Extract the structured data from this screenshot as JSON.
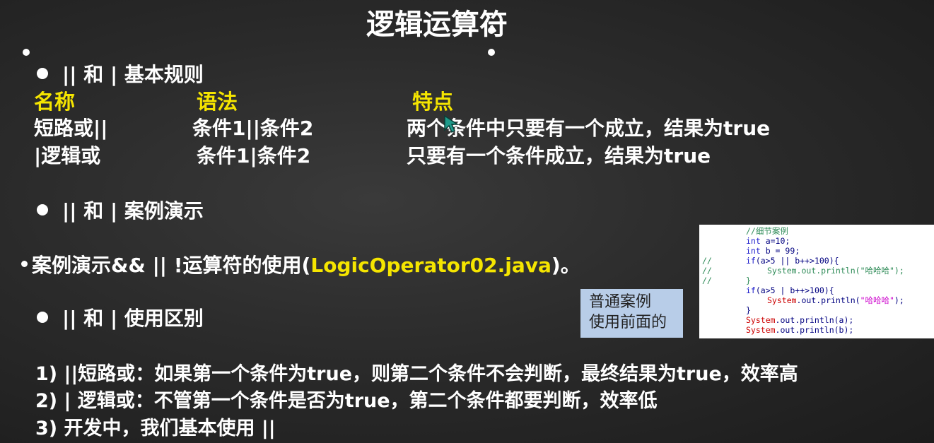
{
  "title": "逻辑运算符",
  "section1": {
    "heading": "|| 和 | 基本规则",
    "col_headers": [
      "名称",
      "语法",
      "特点"
    ],
    "rows": [
      {
        "name": "短路或||",
        "syntax": "条件1||条件2",
        "feature": "两个条件中只要有一个成立，结果为true"
      },
      {
        "name": "|逻辑或",
        "syntax": "条件1|条件2",
        "feature": "只要有一个条件成立，结果为true"
      }
    ]
  },
  "section2": {
    "heading": "|| 和 | 案例演示"
  },
  "demo_line": {
    "prefix": "案例演示&& ||  !运算符的使用(",
    "file": "LogicOperator02.java",
    "suffix": ")。"
  },
  "section3": {
    "heading": "|| 和 | 使用区别"
  },
  "differences": [
    "1) ||短路或：如果第一个条件为true，则第二个条件不会判断，最终结果为true，效率高",
    "2) | 逻辑或：不管第一个条件是否为true，第二个条件都要判断，效率低",
    "3) 开发中，我们基本使用 ||"
  ],
  "note": {
    "line1": "普通案例",
    "line2": "使用前面的"
  },
  "code": {
    "l1": "//细节案例",
    "l2_kw": "int",
    "l2_rest": " a=10;",
    "l3_kw": "int",
    "l3_rest": " b = 99;",
    "l4_cm": "//",
    "l4_kw": "if",
    "l4_rest": "(a>5 || b++>100){",
    "l5_cm": "//",
    "l5_fn": "System",
    "l5_rest": ".out.println(",
    "l5_str": "\"哈哈哈\"",
    "l5_end": ");",
    "l6_cm": "//",
    "l6_rest": "}",
    "l7_kw": "if",
    "l7_rest": "(a>5 | b++>100){",
    "l8_fn": "System",
    "l8_rest": ".out.println(",
    "l8_str": "\"哈哈哈\"",
    "l8_end": ");",
    "l9": "}",
    "l10_fn": "System",
    "l10_rest": ".out.println(a);",
    "l11_fn": "System",
    "l11_rest": ".out.println(b);"
  },
  "colors": {
    "highlight": "#f5e500",
    "note_bg": "#b8cde8",
    "background": "#2b2b2b"
  },
  "icons": {
    "cursor": "arrow-cursor-icon"
  }
}
